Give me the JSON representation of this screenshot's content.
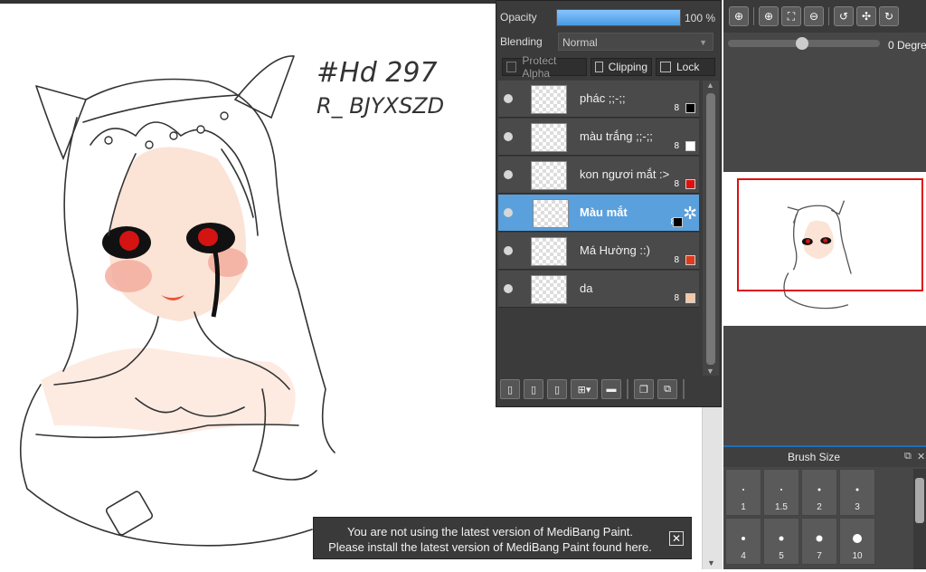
{
  "layer_panel": {
    "opacity_label": "Opacity",
    "opacity_value": "100 %",
    "opacity_fraction": 1.0,
    "blending_label": "Blending",
    "blending_value": "Normal",
    "protect_alpha": "Protect Alpha",
    "clipping": "Clipping",
    "lock": "Lock",
    "layers": [
      {
        "name": "phác ;;-;;",
        "bits": "8",
        "color": "#000000",
        "selected": false
      },
      {
        "name": "màu trắng ;;-;;",
        "bits": "8",
        "color": "#ffffff",
        "selected": false
      },
      {
        "name": "kon ngươi mắt :>",
        "bits": "8",
        "color": "#e01010",
        "selected": false
      },
      {
        "name": "Màu mắt",
        "bits": "8",
        "color": "#000000",
        "selected": true
      },
      {
        "name": "Má Hường ::)",
        "bits": "8",
        "color": "#e03a1a",
        "selected": false
      },
      {
        "name": "da",
        "bits": "8",
        "color": "#f6c7a6",
        "selected": false
      }
    ]
  },
  "navigator": {
    "rotation_value": "0 Degree"
  },
  "brush": {
    "title": "Brush Size",
    "sizes": [
      "1",
      "1.5",
      "2",
      "3",
      "4",
      "5",
      "7",
      "10"
    ]
  },
  "artwork": {
    "signature_line1": "#Hd 297",
    "signature_line2": "R_ BJYXSZD"
  },
  "toast": {
    "line1": "You are not using the latest version of MediBang Paint.",
    "line2": "Please install the latest version of MediBang Paint found here."
  }
}
